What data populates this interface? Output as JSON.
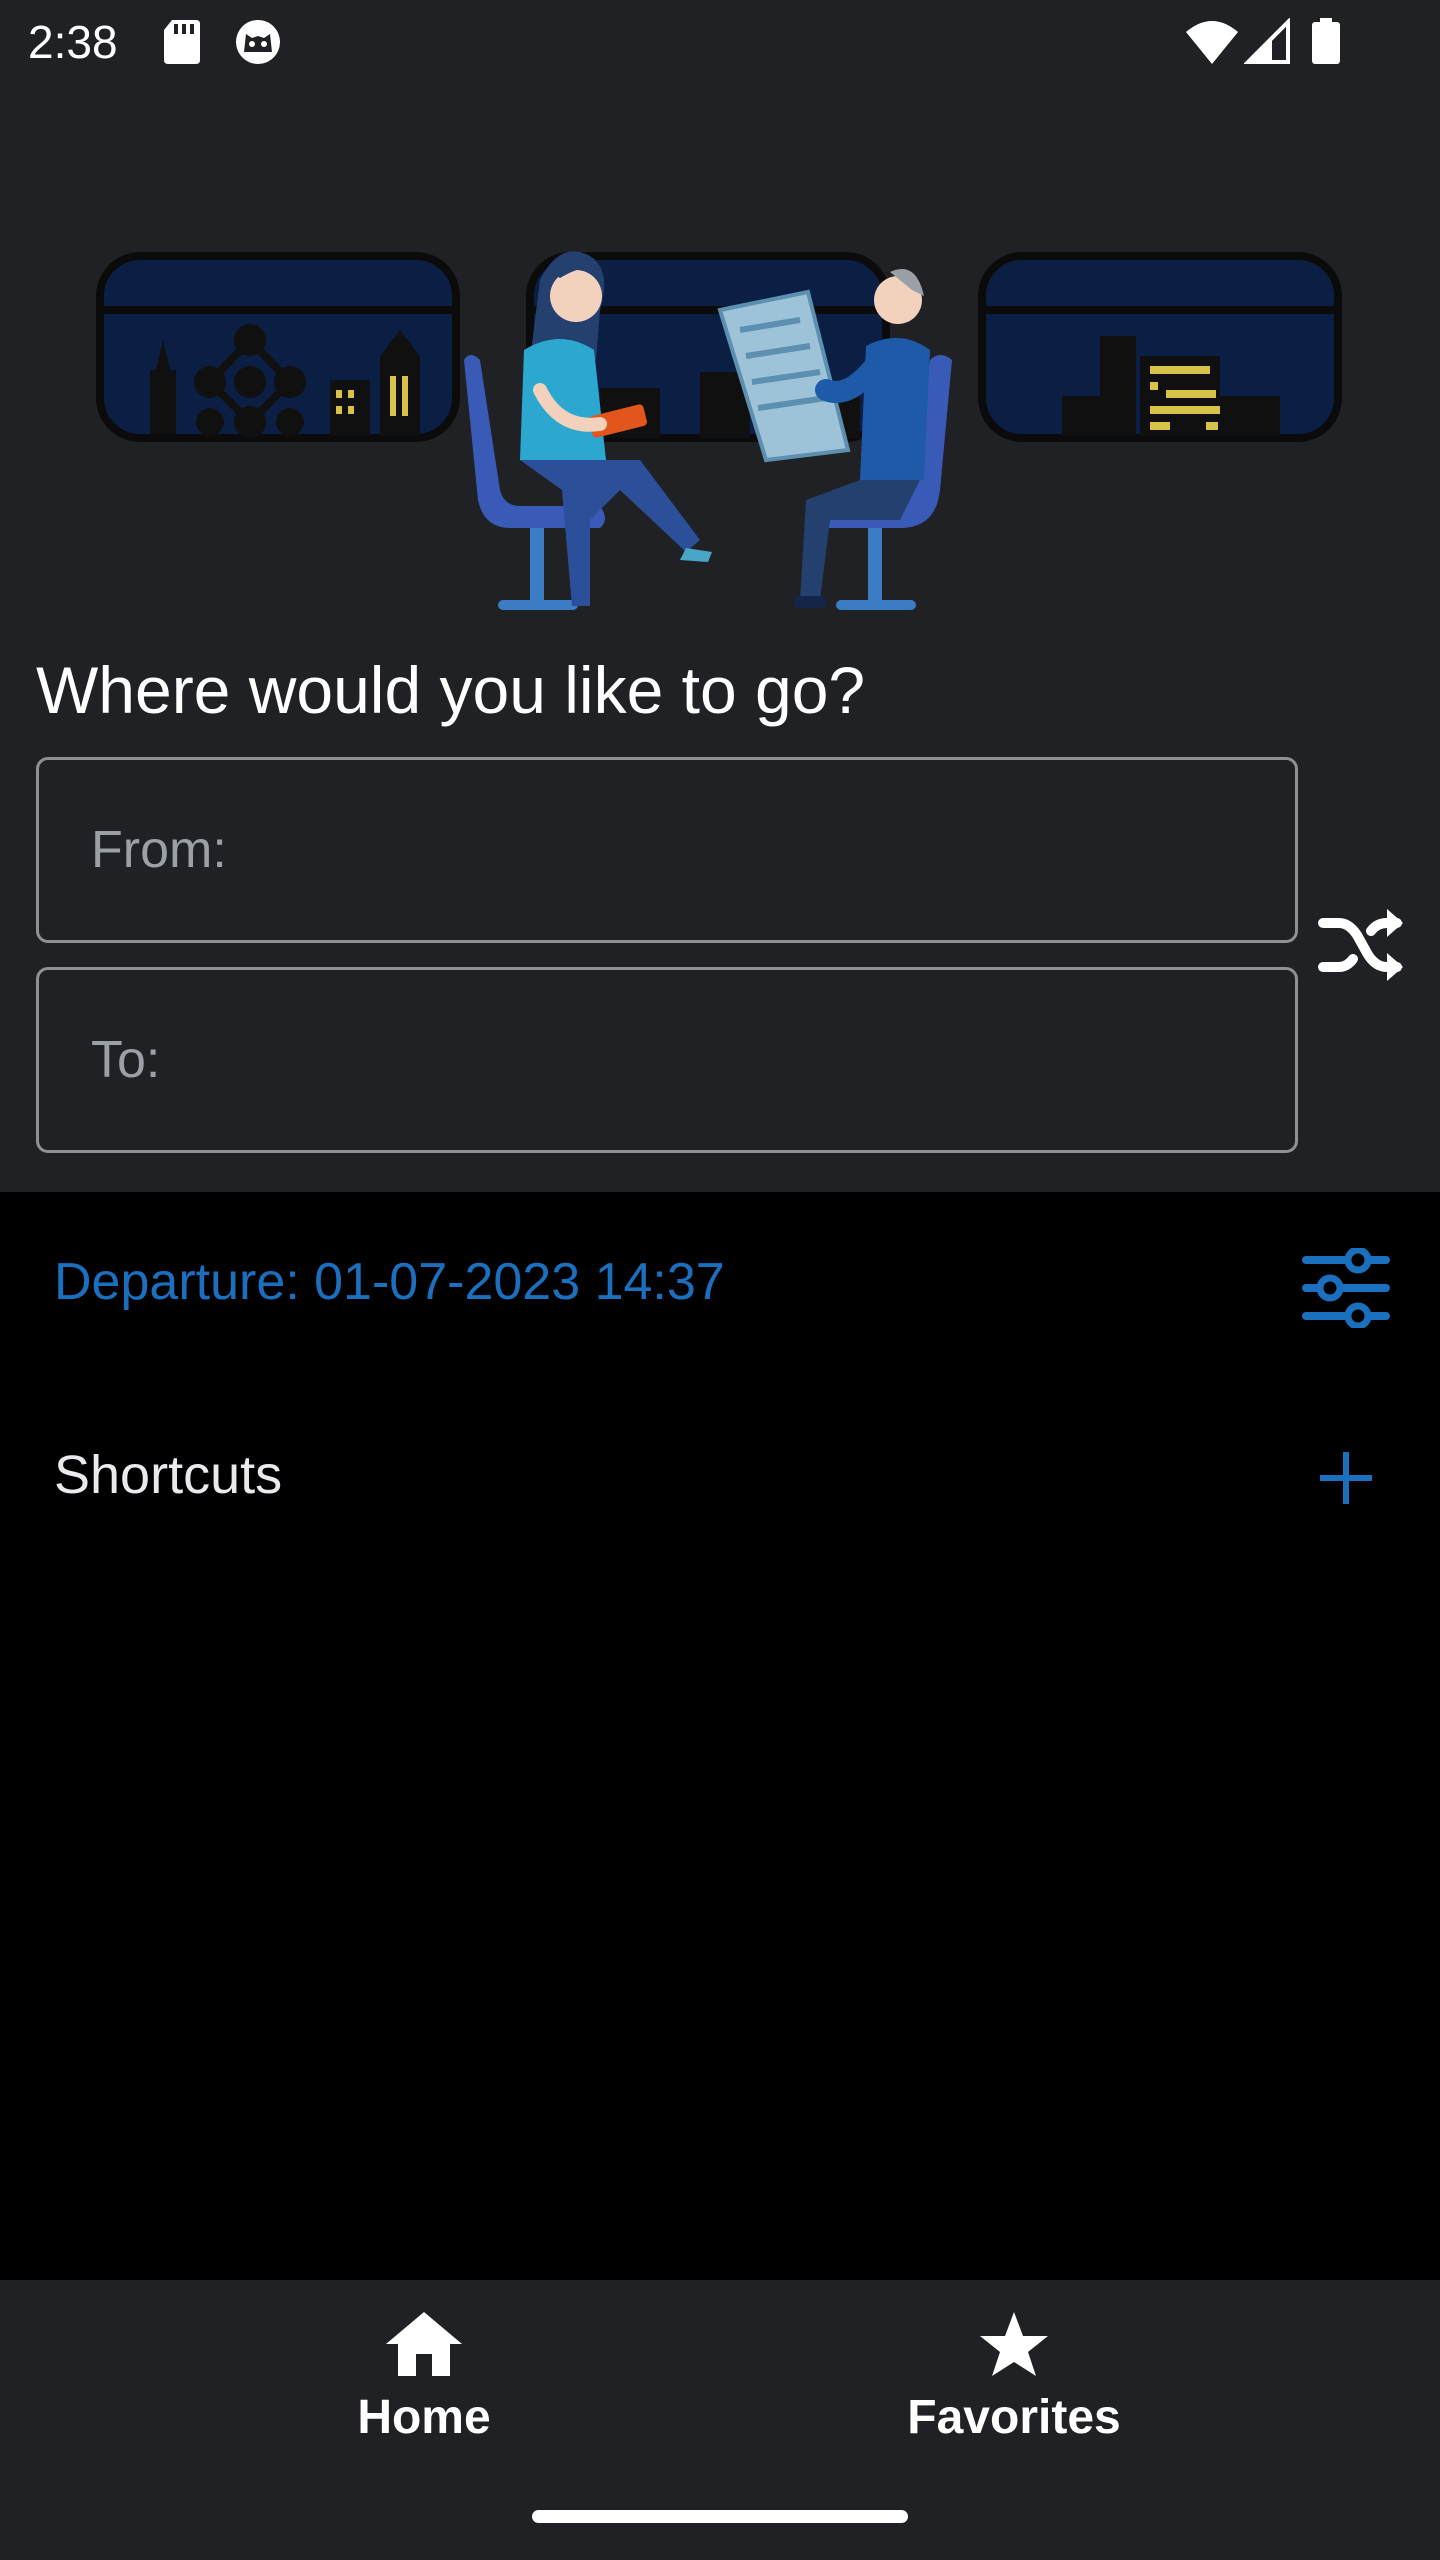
{
  "status_bar": {
    "time": "2:38",
    "icons": [
      "sd-card-icon",
      "cat-face-icon",
      "wifi-icon",
      "signal-icon",
      "battery-icon"
    ]
  },
  "hero": {
    "icon": "train-passengers-illustration"
  },
  "search": {
    "question": "Where would you like to go?",
    "from_placeholder": "From:",
    "from_value": "",
    "to_placeholder": "To:",
    "to_value": "",
    "swap_icon": "shuffle-icon"
  },
  "departure": {
    "label": "Departure: 01-07-2023 14:37",
    "filter_icon": "tune-icon"
  },
  "shortcuts": {
    "title": "Shortcuts",
    "add_icon": "plus-icon"
  },
  "bottom_nav": {
    "items": [
      {
        "label": "Home",
        "icon": "home-icon"
      },
      {
        "label": "Favorites",
        "icon": "star-icon"
      }
    ]
  },
  "colors": {
    "panel": "#202124",
    "background": "#000000",
    "accent": "#1a6fbf",
    "field_border": "#8e9094"
  }
}
